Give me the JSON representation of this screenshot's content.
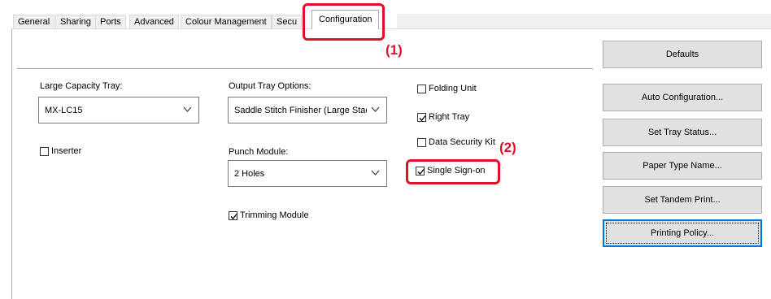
{
  "tabs": [
    "General",
    "Sharing",
    "Ports",
    "Advanced",
    "Colour Management",
    "Secu",
    "Configuration"
  ],
  "callouts": {
    "one": "(1)",
    "two": "(2)"
  },
  "large_capacity_tray": {
    "label": "Large Capacity Tray:",
    "value": "MX-LC15"
  },
  "output_tray_options": {
    "label": "Output Tray Options:",
    "value": "Saddle Stitch Finisher (Large Stack"
  },
  "punch_module": {
    "label": "Punch Module:",
    "value": "2 Holes"
  },
  "checkboxes": {
    "inserter": {
      "label": "Inserter",
      "checked": false
    },
    "trimming_module": {
      "label": "Trimming Module",
      "checked": true
    },
    "folding_unit": {
      "label": "Folding Unit",
      "checked": false
    },
    "right_tray": {
      "label": "Right Tray",
      "checked": true
    },
    "data_security_kit": {
      "label": "Data Security Kit",
      "checked": false
    },
    "single_sign_on": {
      "label": "Single Sign-on",
      "checked": true
    }
  },
  "buttons": {
    "defaults": "Defaults",
    "auto_configuration": "Auto Configuration...",
    "set_tray_status": "Set Tray Status...",
    "paper_type_name": "Paper Type Name...",
    "set_tandem_print": "Set Tandem Print...",
    "printing_policy": "Printing Policy..."
  },
  "colors": {
    "accent_red": "#e0102a",
    "focus_blue": "#0078d7"
  }
}
